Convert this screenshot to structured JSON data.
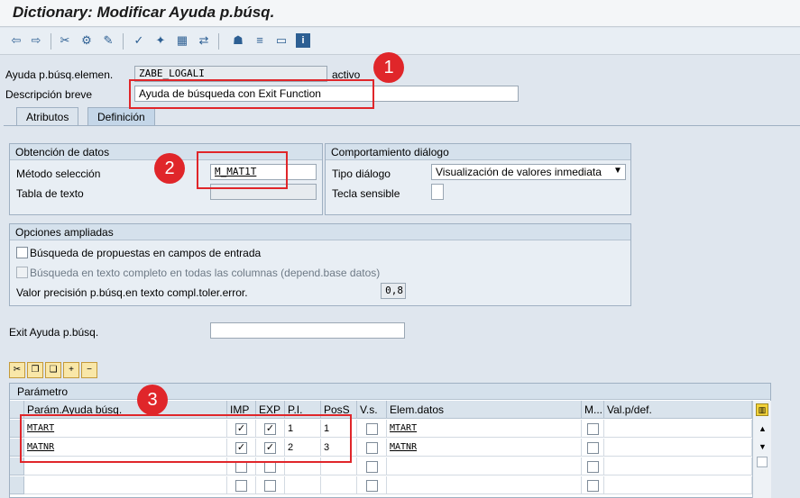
{
  "window": {
    "title": "Dictionary: Modificar Ayuda p.búsq."
  },
  "toolbar": {
    "icons": [
      "back-arrow-icon",
      "forward-arrow-icon",
      "tools-icon",
      "other-object-icon",
      "display-change-icon",
      "hierarchy-icon",
      "check-icon",
      "test-icon",
      "activate-icon",
      "where-used-icon",
      "object-list-icon",
      "layout-icon",
      "info-icon"
    ]
  },
  "header": {
    "helpname_label": "Ayuda p.búsq.elemen.",
    "helpname_value": "ZABE_LOGALI",
    "status": "activo",
    "desc_label": "Descripción breve",
    "desc_value": "Ayuda de búsqueda con Exit Function"
  },
  "tabs": [
    {
      "label": "Atributos",
      "active": false
    },
    {
      "label": "Definición",
      "active": true
    }
  ],
  "data_collection": {
    "title": "Obtención de datos",
    "method_label": "Método selección",
    "method_value": "M_MAT1T",
    "text_table_label": "Tabla de texto",
    "text_table_value": ""
  },
  "dialog_behaviour": {
    "title": "Comportamiento diálogo",
    "dialog_type_label": "Tipo diálogo",
    "dialog_type_value": "Visualización de valores inmediata",
    "hotkey_label": "Tecla sensible",
    "hotkey_value": ""
  },
  "enhanced_options": {
    "title": "Opciones ampliadas",
    "proposal_search_label": "Búsqueda de propuestas en campos de entrada",
    "fulltext_search_label": "Búsqueda en texto completo en todas las columnas (depend.base datos)",
    "accuracy_label": "Valor precisión p.búsq.en texto compl.toler.error.",
    "accuracy_value": "0,8"
  },
  "exit": {
    "label": "Exit Ayuda p.búsq.",
    "value": ""
  },
  "table": {
    "title": "Parámetro",
    "columns": [
      "Parám.Ayuda búsq.",
      "IMP",
      "EXP",
      "P.I.",
      "PosS",
      "V.s.",
      "Elem.datos",
      "M...",
      "Val.p/def."
    ],
    "rows": [
      {
        "param": "MTART",
        "imp": true,
        "exp": true,
        "lpos": "1",
        "spos": "1",
        "sdis": false,
        "rollname": "MTART",
        "mod": false,
        "default": ""
      },
      {
        "param": "MATNR",
        "imp": true,
        "exp": true,
        "lpos": "2",
        "spos": "3",
        "sdis": false,
        "rollname": "MATNR",
        "mod": false,
        "default": ""
      },
      {
        "param": "",
        "imp": false,
        "exp": false,
        "lpos": "",
        "spos": "",
        "sdis": false,
        "rollname": "",
        "mod": false,
        "default": ""
      },
      {
        "param": "",
        "imp": false,
        "exp": false,
        "lpos": "",
        "spos": "",
        "sdis": false,
        "rollname": "",
        "mod": false,
        "default": ""
      }
    ]
  },
  "annotations": [
    "1",
    "2",
    "3"
  ],
  "colors": {
    "highlight": "#e0262a",
    "tab_active": "#c4d6e8"
  }
}
